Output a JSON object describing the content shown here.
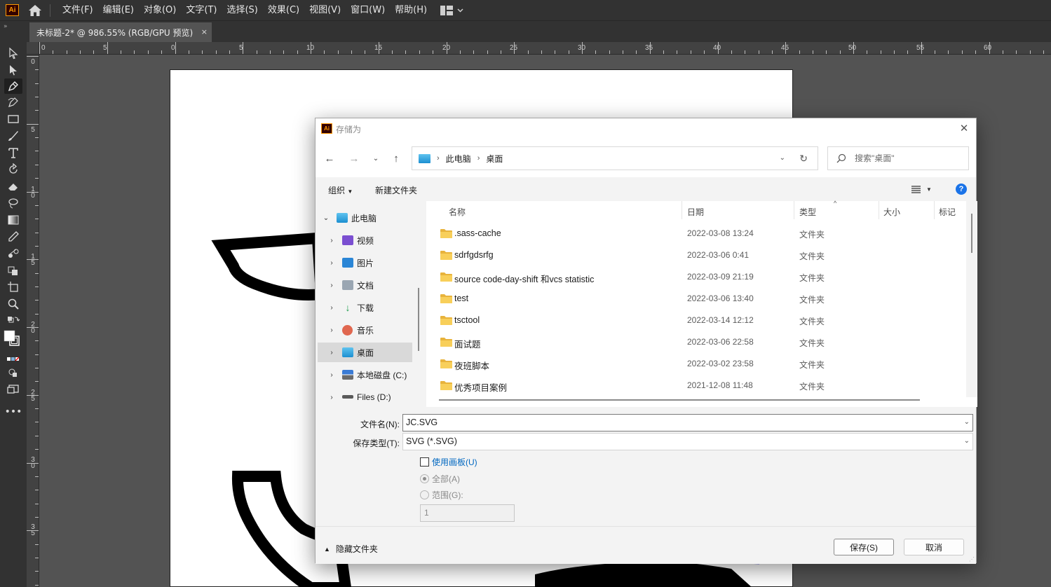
{
  "app": {
    "logo": "Ai",
    "menu": [
      "文件(F)",
      "编辑(E)",
      "对象(O)",
      "文字(T)",
      "选择(S)",
      "效果(C)",
      "视图(V)",
      "窗口(W)",
      "帮助(H)"
    ]
  },
  "document_tab": {
    "title": "未标题-2* @ 986.55% (RGB/GPU 预览)",
    "close": "×"
  },
  "rulers": {
    "top": [
      "0",
      "5",
      "0",
      "5",
      "10",
      "15",
      "20",
      "25",
      "30",
      "35",
      "40",
      "45",
      "50",
      "55",
      "60"
    ],
    "left": [
      "0",
      "5",
      "1 0",
      "1 5",
      "2 0",
      "2 5",
      "3 0",
      "3 5"
    ]
  },
  "dialog": {
    "title": "存储为",
    "close": "✕",
    "path": [
      "此电脑",
      "桌面"
    ],
    "search_placeholder": "搜索\"桌面\"",
    "commands": {
      "organize": "组织",
      "new_folder": "新建文件夹"
    },
    "help": "?",
    "nav_tree": [
      {
        "label": "此电脑",
        "icon": "pc-icon",
        "expanded": true
      },
      {
        "label": "视频",
        "icon": "video-icon"
      },
      {
        "label": "图片",
        "icon": "pictures-icon"
      },
      {
        "label": "文档",
        "icon": "documents-icon"
      },
      {
        "label": "下载",
        "icon": "downloads-icon"
      },
      {
        "label": "音乐",
        "icon": "music-icon"
      },
      {
        "label": "桌面",
        "icon": "desktop-icon",
        "selected": true
      },
      {
        "label": "本地磁盘 (C:)",
        "icon": "drive-c-icon"
      },
      {
        "label": "Files (D:)",
        "icon": "drive-d-icon"
      }
    ],
    "columns": [
      "名称",
      "日期",
      "类型",
      "大小",
      "标记"
    ],
    "files": [
      {
        "name": ".sass-cache",
        "date": "2022-03-08 13:24",
        "type": "文件夹"
      },
      {
        "name": "sdrfgdsrfg",
        "date": "2022-03-06 0:41",
        "type": "文件夹"
      },
      {
        "name": "source code-day-shift 和vcs statistic",
        "date": "2022-03-09 21:19",
        "type": "文件夹"
      },
      {
        "name": "test",
        "date": "2022-03-06 13:40",
        "type": "文件夹"
      },
      {
        "name": "tsctool",
        "date": "2022-03-14 12:12",
        "type": "文件夹"
      },
      {
        "name": "面试题",
        "date": "2022-03-06 22:58",
        "type": "文件夹"
      },
      {
        "name": "夜班脚本",
        "date": "2022-03-02 23:58",
        "type": "文件夹"
      },
      {
        "name": "优秀项目案例",
        "date": "2021-12-08 11:48",
        "type": "文件夹"
      }
    ],
    "filename_label": "文件名(N):",
    "filename_value": "JC.SVG",
    "filetype_label": "保存类型(T):",
    "filetype_value": "SVG (*.SVG)",
    "use_artboards": "使用画板(U)",
    "all": "全部(A)",
    "range": "范围(G):",
    "range_value": "1",
    "hide_folders": "隐藏文件夹",
    "save": "保存(S)",
    "cancel": "取消"
  },
  "colors": {
    "accent": "#1a73e8",
    "ai_orange": "#ff9a00",
    "link_blue": "#0067c0"
  }
}
